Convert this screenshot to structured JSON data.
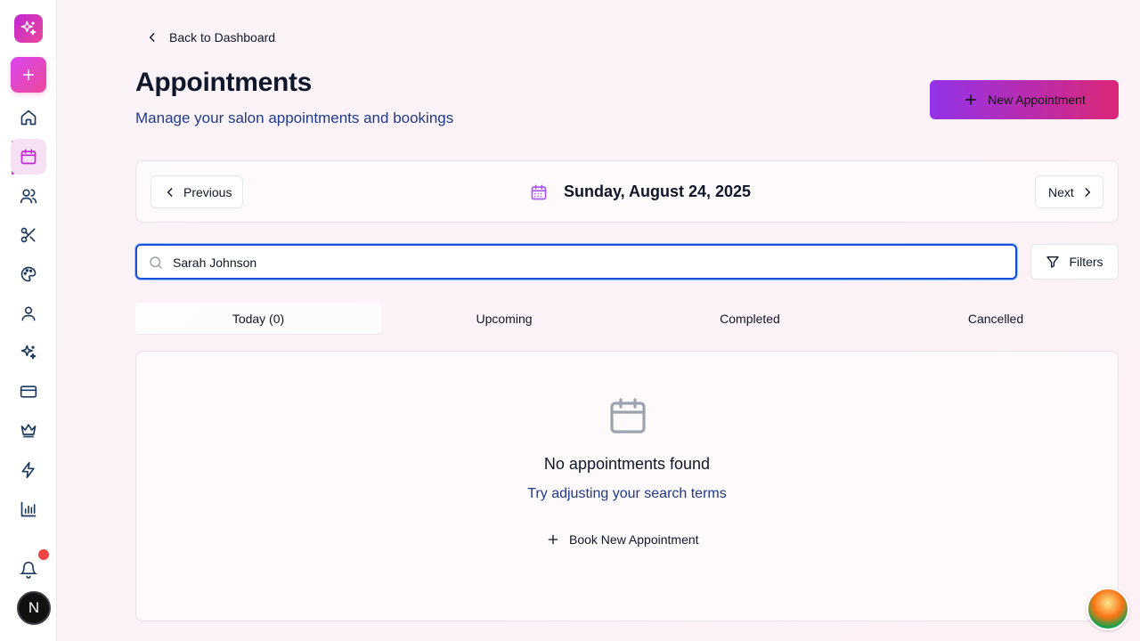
{
  "sidebar": {
    "logo_icon": "sparkles-icon",
    "add_icon": "plus-icon",
    "items": [
      {
        "icon": "home-icon",
        "active": false
      },
      {
        "icon": "calendar-icon",
        "active": true
      },
      {
        "icon": "users-icon",
        "active": false
      },
      {
        "icon": "scissors-icon",
        "active": false
      },
      {
        "icon": "palette-icon",
        "active": false
      },
      {
        "icon": "user-icon",
        "active": false
      },
      {
        "icon": "sparkles-icon",
        "active": false
      },
      {
        "icon": "credit-card-icon",
        "active": false
      },
      {
        "icon": "crown-icon",
        "active": false
      },
      {
        "icon": "zap-icon",
        "active": false
      },
      {
        "icon": "bar-chart-icon",
        "active": false
      }
    ],
    "notifications_icon": "bell-icon",
    "profile_initial": "N"
  },
  "header": {
    "back_label": "Back to Dashboard",
    "title": "Appointments",
    "subtitle": "Manage your salon appointments and bookings",
    "new_button_label": "New Appointment"
  },
  "date_nav": {
    "previous_label": "Previous",
    "date": "Sunday, August 24, 2025",
    "next_label": "Next"
  },
  "search": {
    "value": "Sarah Johnson",
    "filters_label": "Filters"
  },
  "tabs": [
    {
      "label": "Today (0)",
      "active": true
    },
    {
      "label": "Upcoming",
      "active": false
    },
    {
      "label": "Completed",
      "active": false
    },
    {
      "label": "Cancelled",
      "active": false
    }
  ],
  "empty_state": {
    "title": "No appointments found",
    "subtitle": "Try adjusting your search terms",
    "action_label": "Book New Appointment"
  },
  "colors": {
    "accent": "#c026d3",
    "brand_gradient_start": "#9333ea",
    "brand_gradient_end": "#db2777",
    "notification": "#ef4444"
  }
}
